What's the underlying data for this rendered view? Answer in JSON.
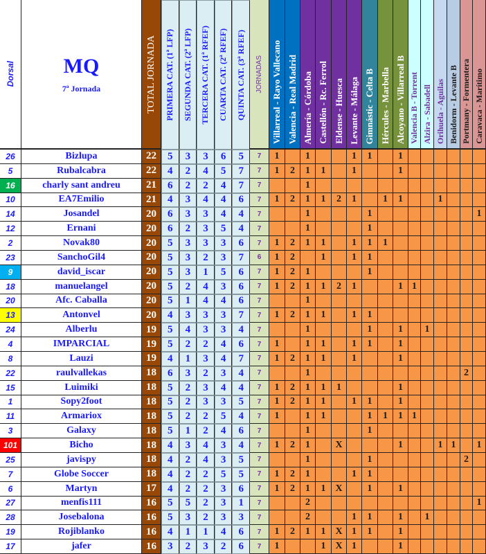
{
  "header": {
    "dorsal_label": "Dorsal",
    "title": "MQ",
    "subtitle": "7ª Jornada",
    "total_label": "TOTAL JORNADA",
    "categories": [
      "PRIMERA CAT. (1ª LFP)",
      "SEGUNDA CAT. (2ª LFP)",
      "TERCERA CAT. (1ª RFEF)",
      "CUARTA CAT. (2ª RFEF)",
      "QUINTA CAT. (3ª RFEF)"
    ],
    "jornadas_label": "JORNADAS",
    "matches": [
      {
        "label": "Villarreal - Rayo Vallecano",
        "bg": "#0070c0",
        "color": "#ffffff"
      },
      {
        "label": "Valencia - Real Madrid",
        "bg": "#0070c0",
        "color": "#ffffff"
      },
      {
        "label": "Almería - Córdoba",
        "bg": "#7030a0",
        "color": "#ffffff"
      },
      {
        "label": "Castellón - Rc. Ferrol",
        "bg": "#7030a0",
        "color": "#ffffff"
      },
      {
        "label": "Eldense - Huesca",
        "bg": "#7030a0",
        "color": "#ffffff"
      },
      {
        "label": "Levante - Málaga",
        "bg": "#7030a0",
        "color": "#ffffff"
      },
      {
        "label": "Gimnástic - Celta B",
        "bg": "#31849b",
        "color": "#ffffff"
      },
      {
        "label": "Hércules - Marbella",
        "bg": "#76923c",
        "color": "#ffffff"
      },
      {
        "label": "Alcoyano - Villarreal B",
        "bg": "#76923c",
        "color": "#ffffff"
      },
      {
        "label": "Valencia B - Torrent",
        "bg": "#ccffff",
        "color": "#7030a0"
      },
      {
        "label": "Alzira - Sabadell",
        "bg": "#ccffff",
        "color": "#7030a0"
      },
      {
        "label": "Orihuela - Aguilas",
        "bg": "#c5d9f1",
        "color": "#7030a0"
      },
      {
        "label": "Benidorm - Levante B",
        "bg": "#b8cce4",
        "color": "#1a1a1a"
      },
      {
        "label": "Portmany - Formentera",
        "bg": "#da9694",
        "color": "#1a1a1a"
      },
      {
        "label": "Caravaca - Marítimo",
        "bg": "#da9694",
        "color": "#1a1a1a"
      }
    ]
  },
  "colors": {
    "dorsal_highlight": {
      "16": "#00b050",
      "9": "#00b0f0",
      "13": "#ffff00",
      "101": "#ff0000"
    },
    "dorsal_highlight_text": {
      "16": "#ffffff",
      "9": "#ffffff",
      "13": "#1a1aff",
      "101": "#ffffff"
    }
  },
  "rows": [
    {
      "dorsal": "26",
      "name": "Bizlupa",
      "total": "22",
      "cats": [
        "5",
        "3",
        "3",
        "6",
        "5"
      ],
      "jornadas": "7",
      "matches": [
        "1",
        "",
        "1",
        "",
        "",
        "1",
        "1",
        "",
        "1",
        "",
        "",
        "",
        "",
        "",
        ""
      ]
    },
    {
      "dorsal": "5",
      "name": "Rubalcabra",
      "total": "22",
      "cats": [
        "4",
        "2",
        "4",
        "5",
        "7"
      ],
      "jornadas": "7",
      "matches": [
        "1",
        "2",
        "1",
        "1",
        "",
        "1",
        "",
        "",
        "1",
        "",
        "",
        "",
        "",
        "",
        ""
      ]
    },
    {
      "dorsal": "16",
      "name": "charly sant andreu",
      "total": "21",
      "cats": [
        "6",
        "2",
        "2",
        "4",
        "7"
      ],
      "jornadas": "7",
      "matches": [
        "",
        "",
        "1",
        "",
        "",
        "",
        "",
        "",
        "",
        "",
        "",
        "",
        "",
        "",
        ""
      ]
    },
    {
      "dorsal": "10",
      "name": "EA7Emilio",
      "total": "21",
      "cats": [
        "4",
        "3",
        "4",
        "4",
        "6"
      ],
      "jornadas": "7",
      "matches": [
        "1",
        "2",
        "1",
        "1",
        "2",
        "1",
        "",
        "1",
        "1",
        "",
        "",
        "1",
        "",
        "",
        ""
      ]
    },
    {
      "dorsal": "14",
      "name": "Josandel",
      "total": "20",
      "cats": [
        "6",
        "3",
        "3",
        "4",
        "4"
      ],
      "jornadas": "7",
      "matches": [
        "",
        "",
        "1",
        "",
        "",
        "",
        "1",
        "",
        "",
        "",
        "",
        "",
        "",
        "",
        "1"
      ]
    },
    {
      "dorsal": "12",
      "name": "Ernani",
      "total": "20",
      "cats": [
        "6",
        "2",
        "3",
        "5",
        "4"
      ],
      "jornadas": "7",
      "matches": [
        "",
        "",
        "1",
        "",
        "",
        "",
        "1",
        "",
        "",
        "",
        "",
        "",
        "",
        "",
        ""
      ]
    },
    {
      "dorsal": "2",
      "name": "Novak80",
      "total": "20",
      "cats": [
        "5",
        "3",
        "3",
        "3",
        "6"
      ],
      "jornadas": "7",
      "matches": [
        "1",
        "2",
        "1",
        "1",
        "",
        "1",
        "1",
        "1",
        "",
        "",
        "",
        "",
        "",
        "",
        ""
      ]
    },
    {
      "dorsal": "23",
      "name": "SanchoGil4",
      "total": "20",
      "cats": [
        "5",
        "3",
        "2",
        "3",
        "7"
      ],
      "jornadas": "6",
      "matches": [
        "1",
        "2",
        "",
        "1",
        "",
        "1",
        "1",
        "",
        "",
        "",
        "",
        "",
        "",
        "",
        ""
      ]
    },
    {
      "dorsal": "9",
      "name": "david_iscar",
      "total": "20",
      "cats": [
        "5",
        "3",
        "1",
        "5",
        "6"
      ],
      "jornadas": "7",
      "matches": [
        "1",
        "2",
        "1",
        "",
        "",
        "",
        "1",
        "",
        "",
        "",
        "",
        "",
        "",
        "",
        ""
      ]
    },
    {
      "dorsal": "18",
      "name": "manuelangel",
      "total": "20",
      "cats": [
        "5",
        "2",
        "4",
        "3",
        "6"
      ],
      "jornadas": "7",
      "matches": [
        "1",
        "2",
        "1",
        "1",
        "2",
        "1",
        "",
        "",
        "1",
        "1",
        "",
        "",
        "",
        "",
        ""
      ]
    },
    {
      "dorsal": "20",
      "name": "Afc. Caballa",
      "total": "20",
      "cats": [
        "5",
        "1",
        "4",
        "4",
        "6"
      ],
      "jornadas": "7",
      "matches": [
        "",
        "",
        "1",
        "",
        "",
        "",
        "",
        "",
        "",
        "",
        "",
        "",
        "",
        "",
        ""
      ]
    },
    {
      "dorsal": "13",
      "name": "Antonvel",
      "total": "20",
      "cats": [
        "4",
        "3",
        "3",
        "3",
        "7"
      ],
      "jornadas": "7",
      "matches": [
        "1",
        "2",
        "1",
        "1",
        "",
        "1",
        "1",
        "",
        "",
        "",
        "",
        "",
        "",
        "",
        ""
      ]
    },
    {
      "dorsal": "24",
      "name": "Alberlu",
      "total": "19",
      "cats": [
        "5",
        "4",
        "3",
        "3",
        "4"
      ],
      "jornadas": "7",
      "matches": [
        "",
        "",
        "1",
        "",
        "",
        "",
        "1",
        "",
        "1",
        "",
        "1",
        "",
        "",
        "",
        ""
      ]
    },
    {
      "dorsal": "4",
      "name": "IMPARCIAL",
      "total": "19",
      "cats": [
        "5",
        "2",
        "2",
        "4",
        "6"
      ],
      "jornadas": "7",
      "matches": [
        "1",
        "",
        "1",
        "1",
        "",
        "1",
        "1",
        "",
        "1",
        "",
        "",
        "",
        "",
        "",
        ""
      ]
    },
    {
      "dorsal": "8",
      "name": "Lauzi",
      "total": "19",
      "cats": [
        "4",
        "1",
        "3",
        "4",
        "7"
      ],
      "jornadas": "7",
      "matches": [
        "1",
        "2",
        "1",
        "1",
        "",
        "1",
        "",
        "",
        "1",
        "",
        "",
        "",
        "",
        "",
        ""
      ]
    },
    {
      "dorsal": "22",
      "name": "raulvallekas",
      "total": "18",
      "cats": [
        "6",
        "3",
        "2",
        "3",
        "4"
      ],
      "jornadas": "7",
      "matches": [
        "",
        "",
        "1",
        "",
        "",
        "",
        "",
        "",
        "",
        "",
        "",
        "",
        "",
        "2",
        ""
      ]
    },
    {
      "dorsal": "15",
      "name": "Luimiki",
      "total": "18",
      "cats": [
        "5",
        "2",
        "3",
        "4",
        "4"
      ],
      "jornadas": "7",
      "matches": [
        "1",
        "2",
        "1",
        "1",
        "1",
        "",
        "",
        "",
        "1",
        "",
        "",
        "",
        "",
        "",
        ""
      ]
    },
    {
      "dorsal": "1",
      "name": "Sopy2foot",
      "total": "18",
      "cats": [
        "5",
        "2",
        "3",
        "3",
        "5"
      ],
      "jornadas": "7",
      "matches": [
        "1",
        "2",
        "1",
        "1",
        "",
        "1",
        "1",
        "",
        "1",
        "",
        "",
        "",
        "",
        "",
        ""
      ]
    },
    {
      "dorsal": "11",
      "name": "Armariox",
      "total": "18",
      "cats": [
        "5",
        "2",
        "2",
        "5",
        "4"
      ],
      "jornadas": "7",
      "matches": [
        "1",
        "",
        "1",
        "1",
        "",
        "",
        "1",
        "1",
        "1",
        "1",
        "",
        "",
        "",
        "",
        ""
      ]
    },
    {
      "dorsal": "3",
      "name": "Galaxy",
      "total": "18",
      "cats": [
        "5",
        "1",
        "2",
        "4",
        "6"
      ],
      "jornadas": "7",
      "matches": [
        "",
        "",
        "1",
        "",
        "",
        "",
        "1",
        "",
        "",
        "",
        "",
        "",
        "",
        "",
        ""
      ]
    },
    {
      "dorsal": "101",
      "name": "Bicho",
      "total": "18",
      "cats": [
        "4",
        "3",
        "4",
        "3",
        "4"
      ],
      "jornadas": "7",
      "matches": [
        "1",
        "2",
        "1",
        "",
        "X",
        "",
        "",
        "",
        "1",
        "",
        "",
        "1",
        "1",
        "",
        "1"
      ]
    },
    {
      "dorsal": "25",
      "name": "javispy",
      "total": "18",
      "cats": [
        "4",
        "2",
        "4",
        "3",
        "5"
      ],
      "jornadas": "7",
      "matches": [
        "",
        "",
        "1",
        "",
        "",
        "",
        "1",
        "",
        "",
        "",
        "",
        "",
        "",
        "2",
        ""
      ]
    },
    {
      "dorsal": "7",
      "name": "Globe Soccer",
      "total": "18",
      "cats": [
        "4",
        "2",
        "2",
        "5",
        "5"
      ],
      "jornadas": "7",
      "matches": [
        "1",
        "2",
        "1",
        "",
        "",
        "1",
        "1",
        "",
        "",
        "",
        "",
        "",
        "",
        "",
        ""
      ]
    },
    {
      "dorsal": "6",
      "name": "Martyn",
      "total": "17",
      "cats": [
        "4",
        "2",
        "2",
        "3",
        "6"
      ],
      "jornadas": "7",
      "matches": [
        "1",
        "2",
        "1",
        "1",
        "X",
        "",
        "1",
        "",
        "1",
        "",
        "",
        "",
        "",
        "",
        ""
      ]
    },
    {
      "dorsal": "27",
      "name": "menfis111",
      "total": "16",
      "cats": [
        "5",
        "5",
        "2",
        "3",
        "1"
      ],
      "jornadas": "7",
      "matches": [
        "",
        "",
        "2",
        "",
        "",
        "",
        "",
        "",
        "",
        "",
        "",
        "",
        "",
        "",
        "1"
      ]
    },
    {
      "dorsal": "28",
      "name": "Josebalona",
      "total": "16",
      "cats": [
        "5",
        "3",
        "2",
        "3",
        "3"
      ],
      "jornadas": "7",
      "matches": [
        "",
        "",
        "2",
        "",
        "",
        "1",
        "1",
        "",
        "1",
        "",
        "1",
        "",
        "",
        "",
        ""
      ]
    },
    {
      "dorsal": "19",
      "name": "Rojiblanko",
      "total": "16",
      "cats": [
        "4",
        "1",
        "1",
        "4",
        "6"
      ],
      "jornadas": "7",
      "matches": [
        "1",
        "2",
        "1",
        "1",
        "X",
        "1",
        "1",
        "",
        "1",
        "",
        "",
        "",
        "",
        "",
        ""
      ]
    },
    {
      "dorsal": "17",
      "name": "jafer",
      "total": "16",
      "cats": [
        "3",
        "2",
        "3",
        "2",
        "6"
      ],
      "jornadas": "7",
      "matches": [
        "1",
        "",
        "",
        "1",
        "X",
        "1",
        "",
        "",
        "1",
        "",
        "",
        "",
        "",
        "",
        ""
      ]
    }
  ]
}
